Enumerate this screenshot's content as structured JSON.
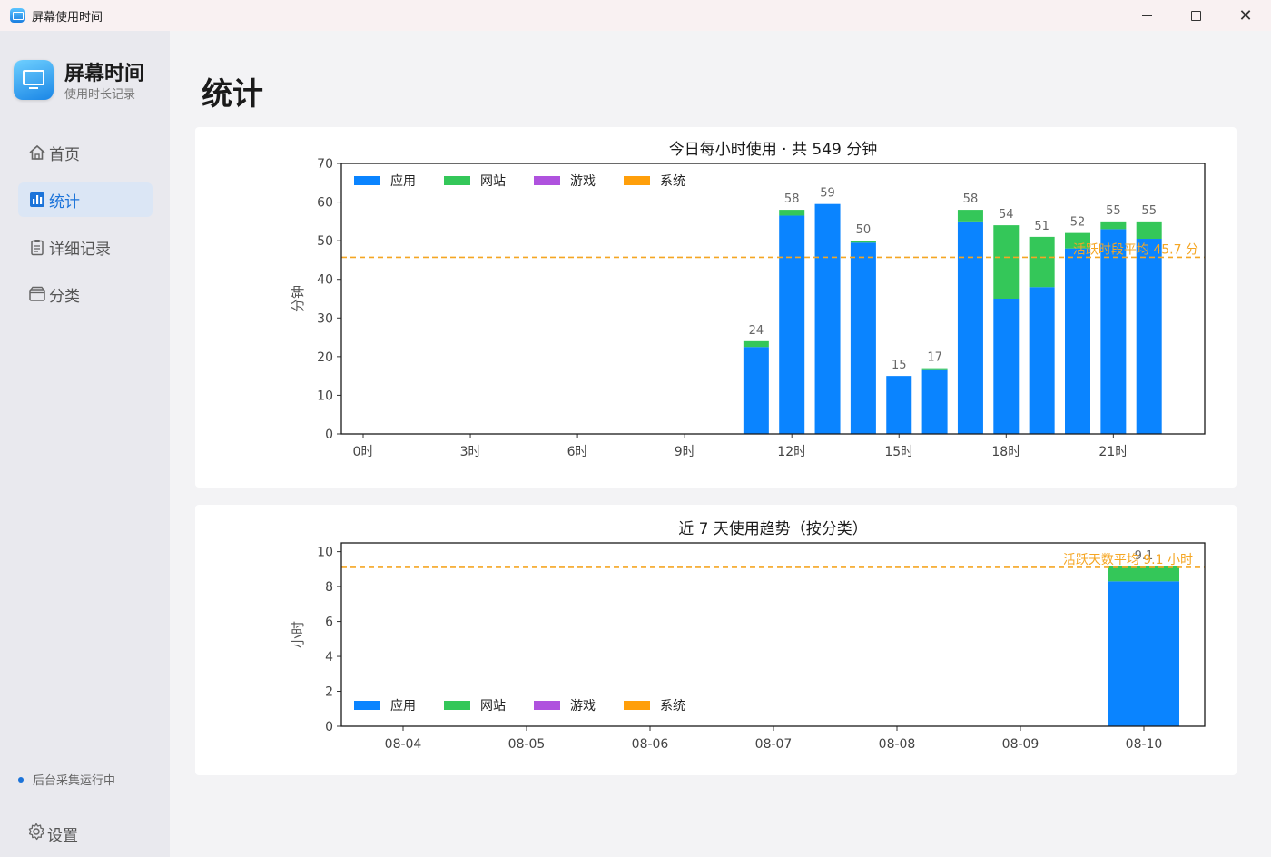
{
  "window": {
    "title": "屏幕使用时间",
    "minimize_icon": "minimize-icon",
    "maximize_icon": "maximize-icon",
    "close_icon": "close-icon"
  },
  "sidebar": {
    "brand_title": "屏幕时间",
    "brand_subtitle": "使用时长记录",
    "items": [
      {
        "label": "首页",
        "icon": "home-icon",
        "active": false
      },
      {
        "label": "统计",
        "icon": "bar-chart-icon",
        "active": true
      },
      {
        "label": "详细记录",
        "icon": "clipboard-icon",
        "active": false
      },
      {
        "label": "分类",
        "icon": "folder-icon",
        "active": false
      }
    ],
    "status_text": "后台采集运行中",
    "settings_label": "设置"
  },
  "page": {
    "title": "统计"
  },
  "colors": {
    "app": "#0a84ff",
    "web": "#34c759",
    "game": "#af52de",
    "system": "#ff9f0a",
    "avg_line": "#f5a623",
    "accent": "#1b73d9"
  },
  "chart_data": [
    {
      "type": "bar",
      "stacked": true,
      "title": "今日每小时使用 · 共 549 分钟",
      "xlabel": "",
      "ylabel": "分钟",
      "ylim": [
        0,
        70
      ],
      "yticks": [
        0,
        10,
        20,
        30,
        40,
        50,
        60,
        70
      ],
      "x": [
        0,
        1,
        2,
        3,
        4,
        5,
        6,
        7,
        8,
        9,
        10,
        11,
        12,
        13,
        14,
        15,
        16,
        17,
        18,
        19,
        20,
        21,
        22
      ],
      "xticks": [
        {
          "x": 0,
          "label": "0时"
        },
        {
          "x": 3,
          "label": "3时"
        },
        {
          "x": 6,
          "label": "6时"
        },
        {
          "x": 9,
          "label": "9时"
        },
        {
          "x": 12,
          "label": "12时"
        },
        {
          "x": 15,
          "label": "15时"
        },
        {
          "x": 18,
          "label": "18时"
        },
        {
          "x": 21,
          "label": "21时"
        }
      ],
      "series": [
        {
          "name": "应用",
          "color": "#0a84ff",
          "values": [
            0,
            0,
            0,
            0,
            0,
            0,
            0,
            0,
            0,
            0,
            0,
            22.5,
            56.5,
            59.5,
            49.5,
            15,
            16.5,
            55,
            35,
            38,
            48,
            53,
            50.5
          ]
        },
        {
          "name": "网站",
          "color": "#34c759",
          "values": [
            0,
            0,
            0,
            0,
            0,
            0,
            0,
            0,
            0,
            0,
            0,
            1.5,
            1.5,
            0,
            0.5,
            0,
            0.5,
            3,
            19,
            13,
            4,
            2,
            4.5
          ]
        },
        {
          "name": "游戏",
          "color": "#af52de",
          "values": [
            0,
            0,
            0,
            0,
            0,
            0,
            0,
            0,
            0,
            0,
            0,
            0,
            0,
            0,
            0,
            0,
            0,
            0,
            0,
            0,
            0,
            0,
            0
          ]
        },
        {
          "name": "系统",
          "color": "#ff9f0a",
          "values": [
            0,
            0,
            0,
            0,
            0,
            0,
            0,
            0,
            0,
            0,
            0,
            0,
            0,
            0,
            0,
            0,
            0,
            0,
            0,
            0,
            0,
            0,
            0
          ]
        }
      ],
      "bar_labels": [
        null,
        null,
        null,
        null,
        null,
        null,
        null,
        null,
        null,
        null,
        null,
        "24",
        "58",
        "59",
        "50",
        "15",
        "17",
        "58",
        "54",
        "51",
        "52",
        "55",
        "55"
      ],
      "average": {
        "value": 45.7,
        "label": "活跃时段平均 45.7 分"
      },
      "legend": "top-left",
      "grid": false
    },
    {
      "type": "bar",
      "stacked": true,
      "title": "近 7 天使用趋势（按分类）",
      "xlabel": "",
      "ylabel": "小时",
      "ylim": [
        0,
        10.5
      ],
      "yticks": [
        0,
        2,
        4,
        6,
        8,
        10
      ],
      "categories": [
        "08-04",
        "08-05",
        "08-06",
        "08-07",
        "08-08",
        "08-09",
        "08-10"
      ],
      "series": [
        {
          "name": "应用",
          "color": "#0a84ff",
          "values": [
            0,
            0,
            0,
            0,
            0,
            0,
            8.3
          ]
        },
        {
          "name": "网站",
          "color": "#34c759",
          "values": [
            0,
            0,
            0,
            0,
            0,
            0,
            0.85
          ]
        },
        {
          "name": "游戏",
          "color": "#af52de",
          "values": [
            0,
            0,
            0,
            0,
            0,
            0,
            0
          ]
        },
        {
          "name": "系统",
          "color": "#ff9f0a",
          "values": [
            0,
            0,
            0,
            0,
            0,
            0,
            0
          ]
        }
      ],
      "bar_labels": [
        null,
        null,
        null,
        null,
        null,
        null,
        "9.1"
      ],
      "average": {
        "value": 9.1,
        "label": "活跃天数平均 9.1 小时"
      },
      "legend": "bottom-left",
      "grid": false
    }
  ]
}
